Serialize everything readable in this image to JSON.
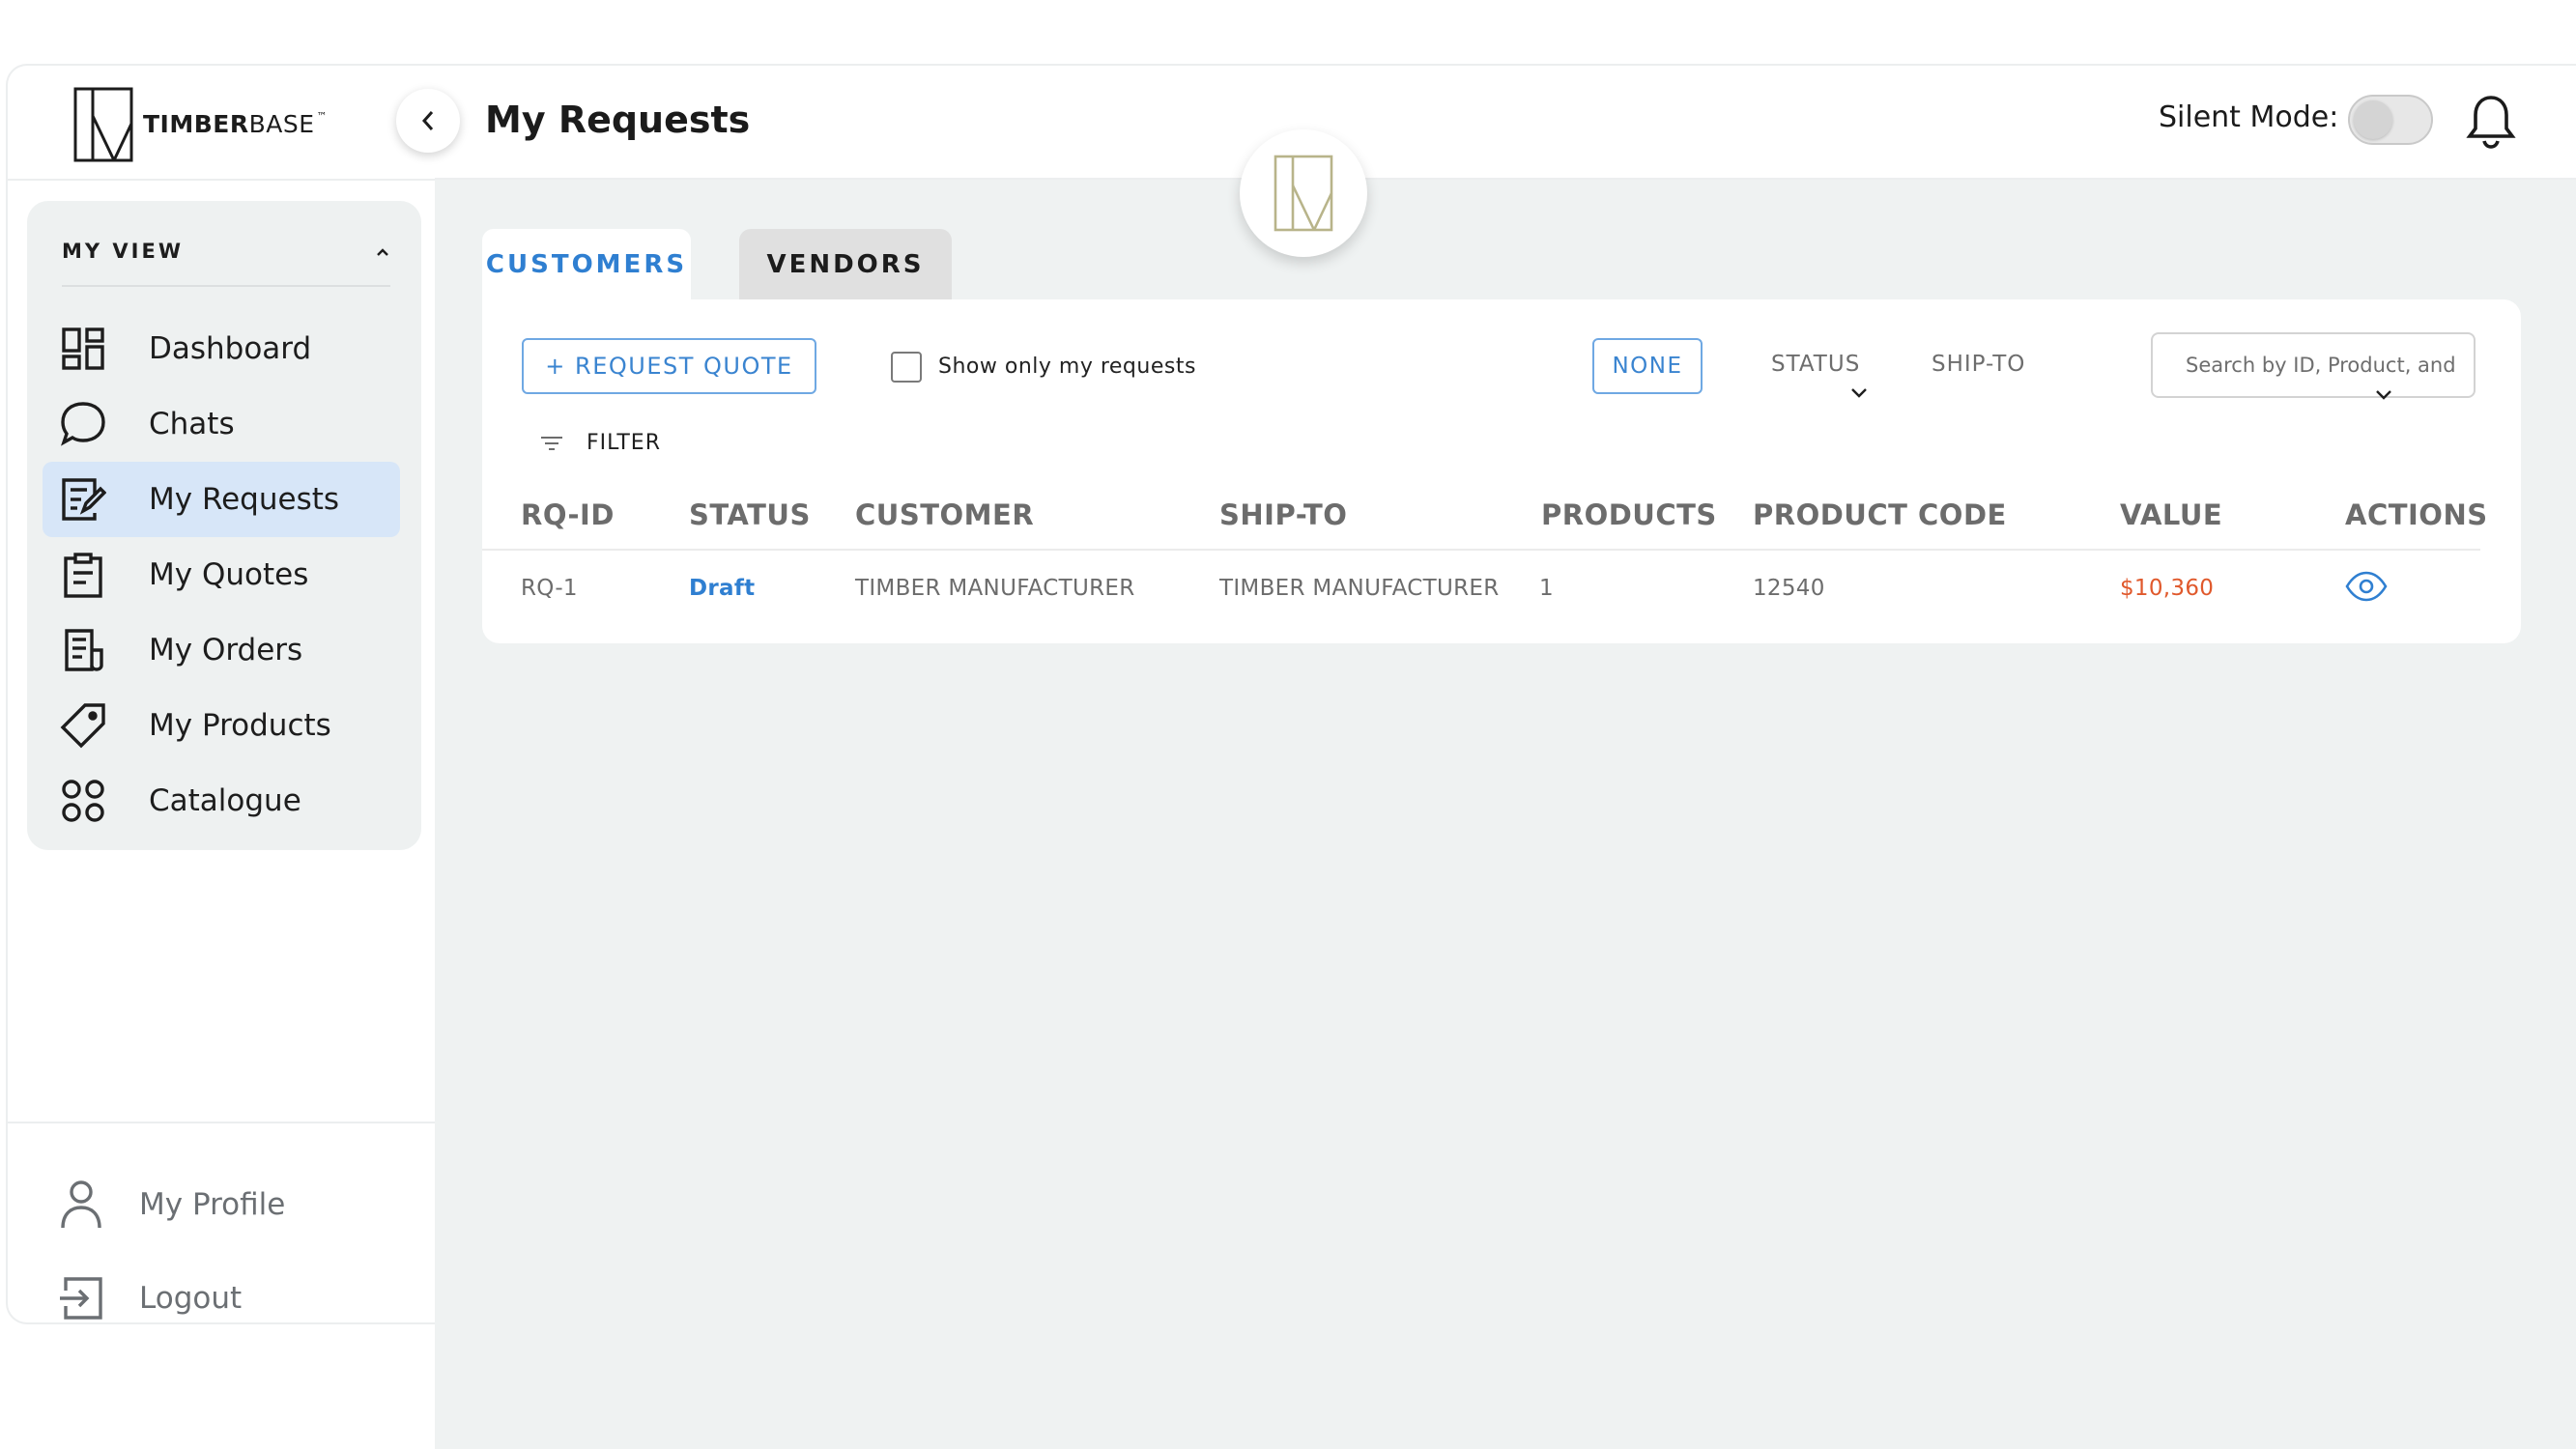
{
  "brand": {
    "name_bold": "TIMBER",
    "name_light": "BASE",
    "trademark": "™"
  },
  "sidebar": {
    "section_title": "MY VIEW",
    "items": [
      {
        "label": "Dashboard",
        "icon": "dashboard-icon",
        "active": false
      },
      {
        "label": "Chats",
        "icon": "chat-bubble-icon",
        "active": false
      },
      {
        "label": "My Requests",
        "icon": "request-edit-icon",
        "active": true
      },
      {
        "label": "My Quotes",
        "icon": "clipboard-icon",
        "active": false
      },
      {
        "label": "My Orders",
        "icon": "receipt-icon",
        "active": false
      },
      {
        "label": "My Products",
        "icon": "price-tag-icon",
        "active": false
      },
      {
        "label": "Catalogue",
        "icon": "four-circles-icon",
        "active": false
      }
    ],
    "bottom_items": [
      {
        "label": "My Profile",
        "icon": "user-icon"
      },
      {
        "label": "Logout",
        "icon": "logout-icon"
      }
    ]
  },
  "header": {
    "title": "My Requests",
    "silent_mode_label": "Silent Mode:",
    "silent_mode_on": false
  },
  "tabs": [
    {
      "label": "CUSTOMERS",
      "active": true
    },
    {
      "label": "VENDORS",
      "active": false
    }
  ],
  "toolbar": {
    "request_quote_label": "+ REQUEST QUOTE",
    "show_mine_label": "Show only my requests",
    "show_mine_checked": false,
    "group_none_label": "NONE",
    "group_status_label": "STATUS",
    "group_shipto_label": "SHIP-TO",
    "search_placeholder": "Search by ID, Product, and",
    "filter_label": "FILTER"
  },
  "table": {
    "columns": [
      "RQ-ID",
      "STATUS",
      "CUSTOMER",
      "SHIP-TO",
      "PRODUCTS",
      "PRODUCT CODE",
      "VALUE",
      "ACTIONS"
    ],
    "rows": [
      {
        "rq_id": "RQ-1",
        "status": "Draft",
        "customer": "TIMBER MANUFACTURER",
        "ship_to": "TIMBER MANUFACTURER",
        "products": "1",
        "product_code": "12540",
        "value": "$10,360",
        "action_icon": "eye-icon"
      }
    ]
  },
  "colors": {
    "accent": "#2f7fd1",
    "active_nav_bg": "#d7e6f8",
    "value_orange": "#e0592c",
    "background": "#eff2f2",
    "logo_olive": "#b8b48a"
  }
}
